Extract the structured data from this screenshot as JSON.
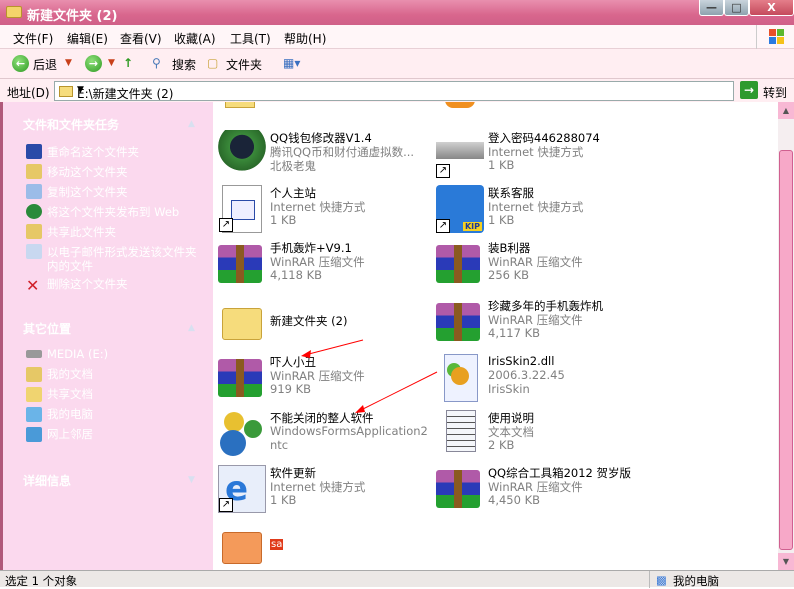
{
  "window": {
    "title": "新建文件夹 (2)",
    "minimize": "—",
    "maximize": "□",
    "close": "X"
  },
  "menu": [
    "文件(F)",
    "编辑(E)",
    "查看(V)",
    "收藏(A)",
    "工具(T)",
    "帮助(H)"
  ],
  "toolbar": {
    "back": "后退",
    "search": "搜索",
    "folders": "文件夹"
  },
  "address": {
    "label": "地址(D)",
    "value": "E:\\新建文件夹 (2)",
    "go": "转到"
  },
  "sidebar": {
    "tasks_title": "文件和文件夹任务",
    "tasks": [
      "重命名这个文件夹",
      "移动这个文件夹",
      "复制这个文件夹",
      "将这个文件夹发布到 Web",
      "共享此文件夹",
      "以电子邮件形式发送该文件夹内的文件",
      "删除这个文件夹"
    ],
    "places_title": "其它位置",
    "places": [
      "MEDIA (E:)",
      "我的文档",
      "共享文档",
      "我的电脑",
      "网上邻居"
    ],
    "details_title": "详细信息"
  },
  "files": [
    {
      "name": "QQ钱包修改器V1.4",
      "d1": "腾讯QQ币和财付通虚拟数...",
      "d2": "北极老鬼",
      "icon": "qq-penguin"
    },
    {
      "name": "登入密码446288074",
      "d1": "Internet 快捷方式",
      "d2": "1 KB",
      "icon": "drive-shortcut"
    },
    {
      "name": "个人主站",
      "d1": "Internet 快捷方式",
      "d2": "1 KB",
      "icon": "web-shortcut"
    },
    {
      "name": "联系客服",
      "d1": "Internet 快捷方式",
      "d2": "1 KB",
      "icon": "qq-kip-shortcut"
    },
    {
      "name": "手机轰炸+V9.1",
      "d1": "WinRAR 压缩文件",
      "d2": "4,118 KB",
      "icon": "winrar"
    },
    {
      "name": "装B利器",
      "d1": "WinRAR 压缩文件",
      "d2": "256 KB",
      "icon": "winrar"
    },
    {
      "name": "新建文件夹 (2)",
      "d1": "",
      "d2": "",
      "icon": "folder"
    },
    {
      "name": "珍藏多年的手机轰炸机",
      "d1": "WinRAR 压缩文件",
      "d2": "4,117 KB",
      "icon": "winrar"
    },
    {
      "name": "吓人小丑",
      "d1": "WinRAR 压缩文件",
      "d2": "919 KB",
      "icon": "winrar"
    },
    {
      "name": "IrisSkin2.dll",
      "d1": "2006.3.22.45",
      "d2": "IrisSkin",
      "icon": "dll"
    },
    {
      "name": "不能关闭的整人软件",
      "d1": "WindowsFormsApplication2",
      "d2": "ntc",
      "icon": "gears"
    },
    {
      "name": "使用说明",
      "d1": "文本文档",
      "d2": "2 KB",
      "icon": "notepad"
    },
    {
      "name": "软件更新",
      "d1": "Internet 快捷方式",
      "d2": "1 KB",
      "icon": "ie-shortcut"
    },
    {
      "name": "QQ综合工具箱2012 贺岁版",
      "d1": "WinRAR 压缩文件",
      "d2": "4,450 KB",
      "icon": "winrar"
    },
    {
      "name": "sa",
      "d1": "",
      "d2": "",
      "icon": "folder-orange"
    }
  ],
  "status": {
    "left": "选定 1 个对象",
    "right": "我的电脑"
  },
  "colors": {
    "sidebar": "#fbd9ee",
    "title": "#d8668d",
    "annotation": "#ff0000"
  }
}
